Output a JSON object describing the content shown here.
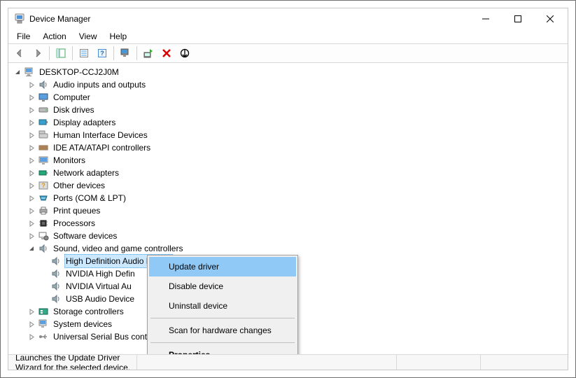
{
  "window": {
    "title": "Device Manager"
  },
  "menu": {
    "file": "File",
    "action": "Action",
    "view": "View",
    "help": "Help"
  },
  "tree": {
    "root": "DESKTOP-CCJ2J0M",
    "audio": "Audio inputs and outputs",
    "computer": "Computer",
    "disk": "Disk drives",
    "display": "Display adapters",
    "hid": "Human Interface Devices",
    "ide": "IDE ATA/ATAPI controllers",
    "monitors": "Monitors",
    "network": "Network adapters",
    "other": "Other devices",
    "ports": "Ports (COM & LPT)",
    "printq": "Print queues",
    "cpu": "Processors",
    "sw": "Software devices",
    "sound": "Sound, video and game controllers",
    "sound_hda": "High Definition Audio Device",
    "sound_nvhd": "NVIDIA High Defin",
    "sound_nvva": "NVIDIA Virtual Au",
    "sound_usb": "USB Audio Device",
    "storage": "Storage controllers",
    "system": "System devices",
    "usb": "Universal Serial Bus controllers"
  },
  "context_menu": {
    "update": "Update driver",
    "disable": "Disable device",
    "uninstall": "Uninstall device",
    "scan": "Scan for hardware changes",
    "properties": "Properties"
  },
  "status": {
    "text": "Launches the Update Driver Wizard for the selected device."
  }
}
